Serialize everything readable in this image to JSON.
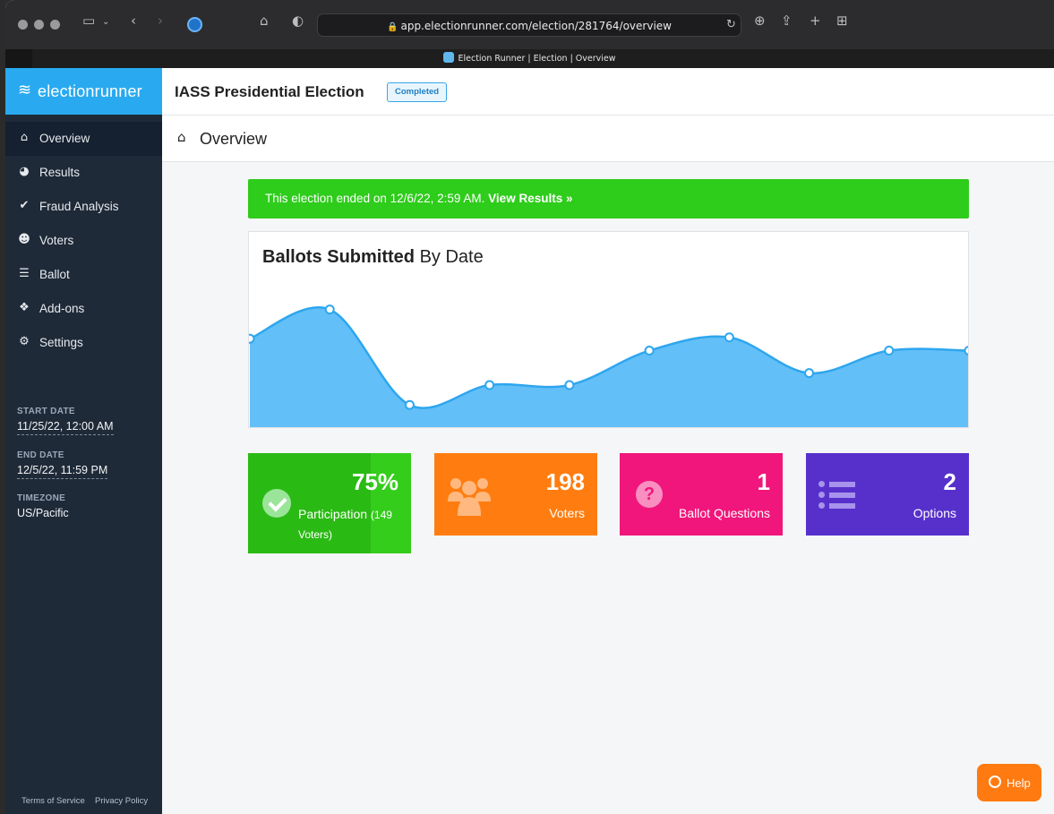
{
  "browser": {
    "url": "app.electionrunner.com/election/281764/overview",
    "tab_title": "Election Runner | Election | Overview"
  },
  "brand": {
    "logo_text": "electionrunner"
  },
  "sidebar": {
    "items": [
      {
        "label": "Overview",
        "icon": "home-icon",
        "active": true
      },
      {
        "label": "Results",
        "icon": "pie-chart-icon"
      },
      {
        "label": "Fraud Analysis",
        "icon": "check-icon"
      },
      {
        "label": "Voters",
        "icon": "users-icon"
      },
      {
        "label": "Ballot",
        "icon": "list-icon"
      },
      {
        "label": "Add-ons",
        "icon": "cubes-icon"
      },
      {
        "label": "Settings",
        "icon": "gear-icon"
      }
    ],
    "start_date_label": "START DATE",
    "start_date": "11/25/22, 12:00 AM",
    "end_date_label": "END DATE",
    "end_date": "12/5/22, 11:59 PM",
    "timezone_label": "TIMEZONE",
    "timezone": "US/Pacific",
    "terms": "Terms of Service",
    "privacy": "Privacy Policy"
  },
  "header": {
    "title": "IASS Presidential Election",
    "status": "Completed"
  },
  "subheader": {
    "title": "Overview"
  },
  "alert": {
    "text": "This election ended on 12/6/22, 2:59 AM. ",
    "link": "View Results »",
    "color": "#2ecc1b"
  },
  "chart_data": {
    "type": "area",
    "title_bold": "Ballots Submitted",
    "title_rest": " By Date",
    "values": [
      60,
      82,
      10,
      25,
      25,
      51,
      61,
      34,
      51,
      51
    ],
    "ylim": [
      0,
      100
    ],
    "color": "#63bff8"
  },
  "stats": {
    "participation": {
      "value": "75%",
      "label": "Participation",
      "sub": "(149 Voters)",
      "color": "#2aba14"
    },
    "voters": {
      "value": "198",
      "label": "Voters",
      "color": "#ff7d10"
    },
    "questions": {
      "value": "1",
      "label": "Ballot Questions",
      "color": "#f0167b"
    },
    "options": {
      "value": "2",
      "label": "Options",
      "color": "#5730cc"
    }
  },
  "help": {
    "label": "Help"
  }
}
